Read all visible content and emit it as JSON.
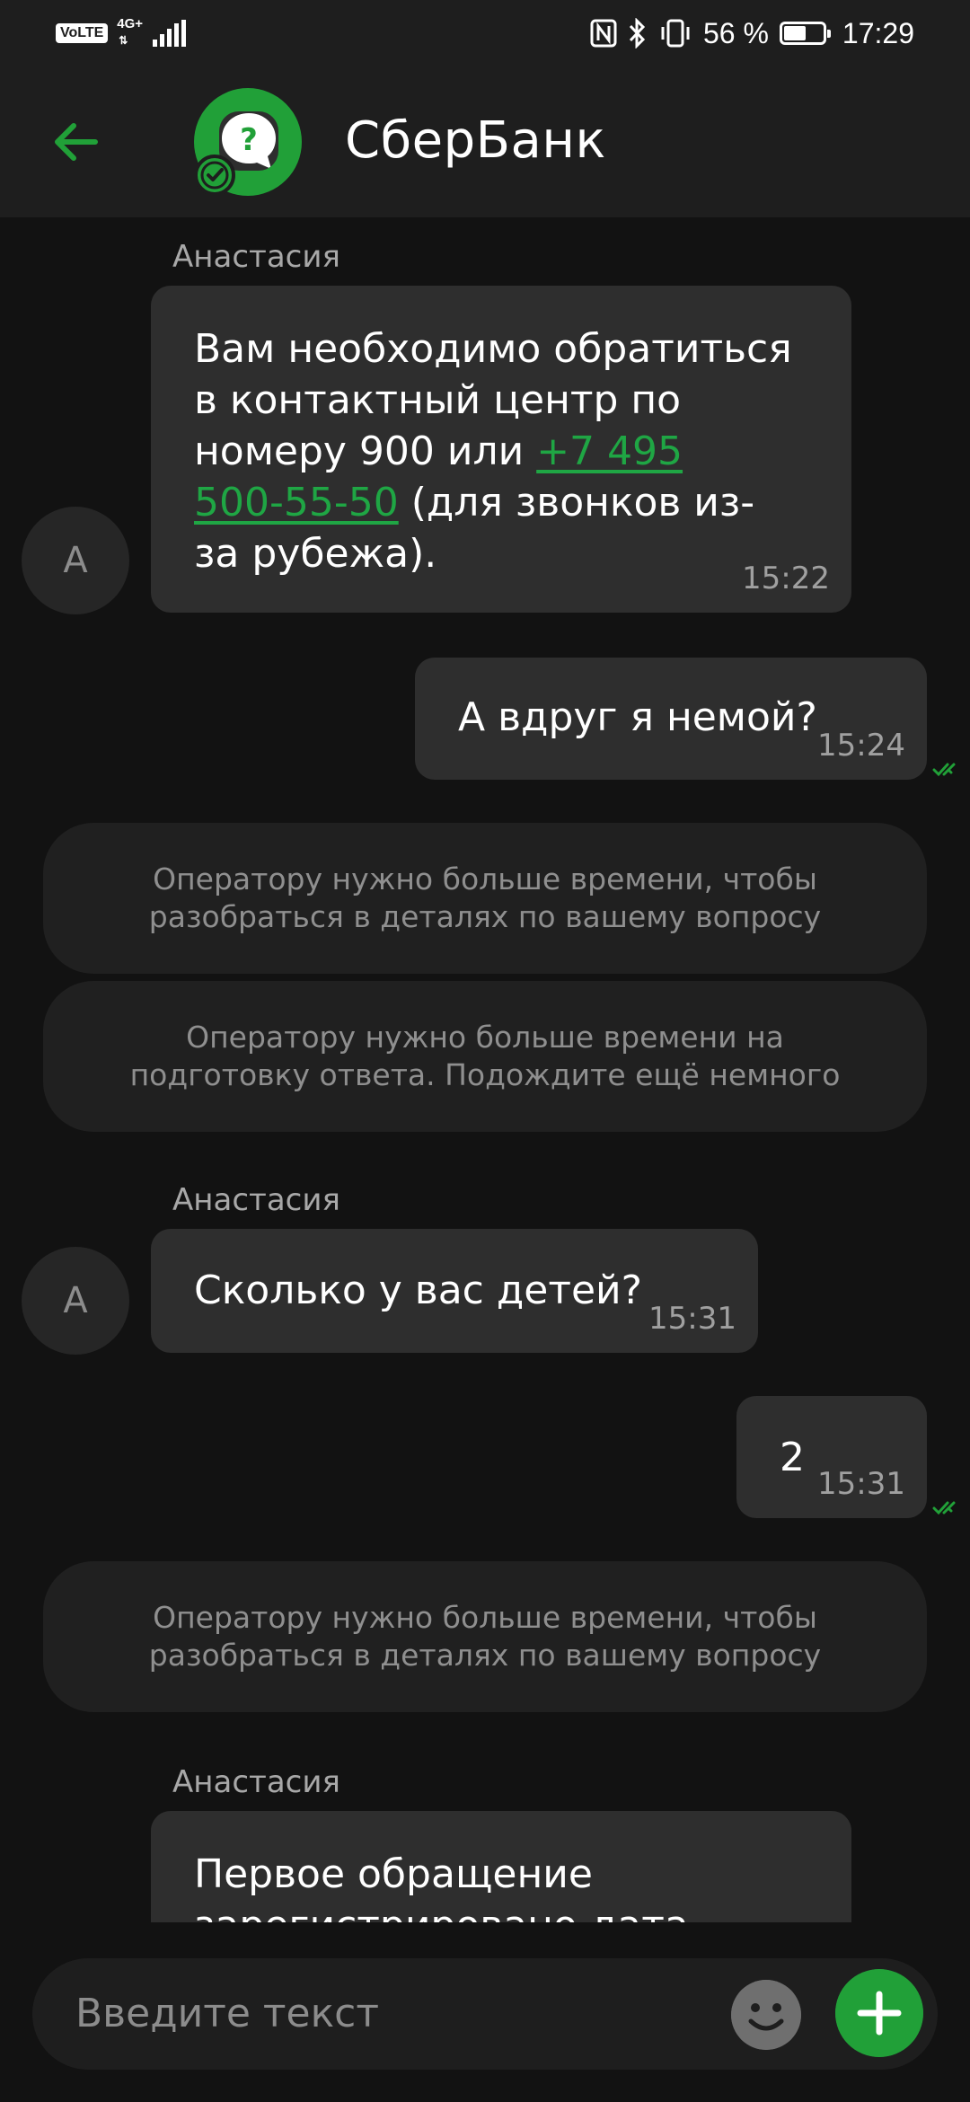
{
  "status_bar": {
    "volte": "VoLTE",
    "network": "4G+",
    "battery": "56 %",
    "battery_level": 0.56,
    "time": "17:29"
  },
  "header": {
    "title": "СберБанк",
    "back_icon": "arrow-left-icon",
    "avatar_icon": "help-bubble-icon",
    "brand_color": "#21a038"
  },
  "chat": {
    "messages": [
      {
        "sender": "Анастасия",
        "avatar_letter": "А",
        "text_before": "Вам необходимо обратиться в контактный центр по номеру 900 или ",
        "link_line1": "+7 495",
        "link_line2": "500-55-50",
        "text_after": " (для звонков из-за рубежа).",
        "time": "15:22"
      },
      {
        "text": "А вдруг я немой?",
        "time": "15:24"
      },
      {
        "text": "Оператору нужно больше времени, чтобы разобраться в деталях по вашему вопросу"
      },
      {
        "text": "Оператору нужно больше времени на подготовку ответа. Подождите ещё немного"
      },
      {
        "sender": "Анастасия",
        "avatar_letter": "А",
        "text": "Сколько у вас детей?",
        "time": "15:31"
      },
      {
        "text": "2",
        "time": "15:31"
      },
      {
        "text": "Оператору нужно больше времени, чтобы разобраться в деталях по вашему вопросу"
      },
      {
        "sender": "Анастасия",
        "text": "Первое обращение зарегистрировано дата"
      }
    ]
  },
  "input": {
    "placeholder": "Введите текст",
    "emoji_icon": "smiley-icon",
    "add_icon": "plus-icon"
  }
}
